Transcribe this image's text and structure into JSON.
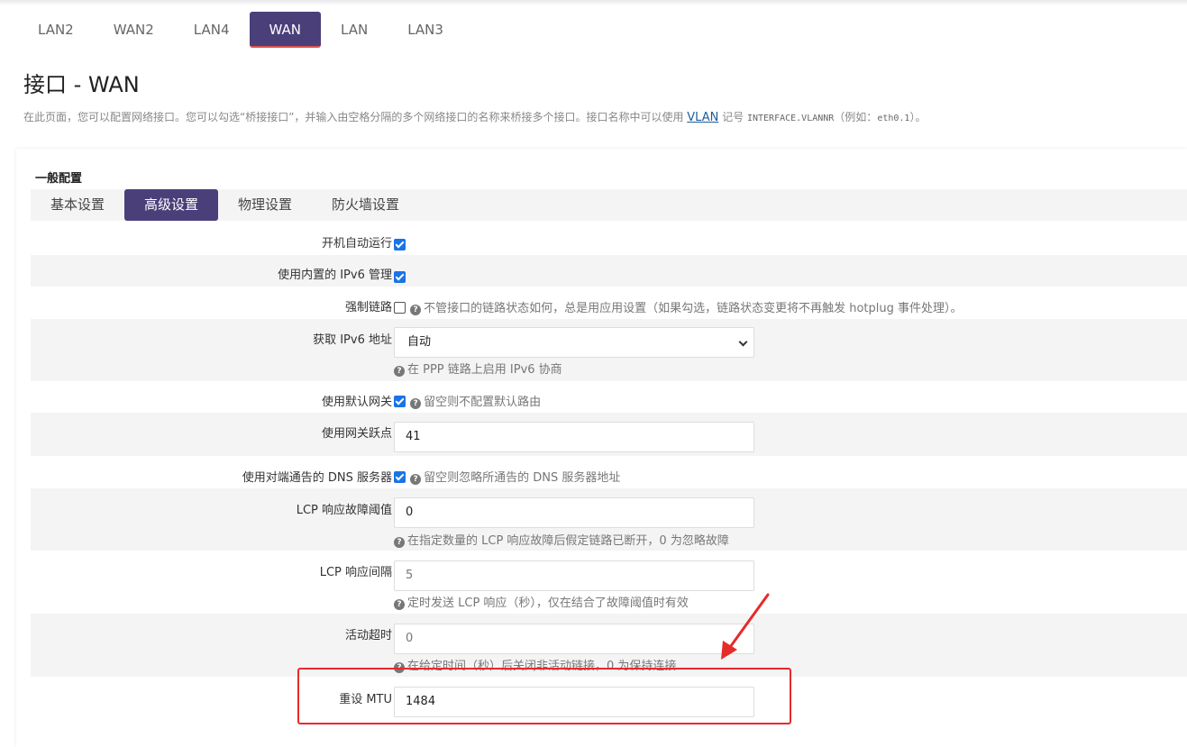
{
  "interface_tabs": [
    {
      "label": "LAN2",
      "active": false
    },
    {
      "label": "WAN2",
      "active": false
    },
    {
      "label": "LAN4",
      "active": false
    },
    {
      "label": "WAN",
      "active": true
    },
    {
      "label": "LAN",
      "active": false
    },
    {
      "label": "LAN3",
      "active": false
    }
  ],
  "page": {
    "title": "接口 - WAN",
    "desc_before": "在此页面，您可以配置网络接口。您可以勾选“桥接接口”，并输入由空格分隔的多个网络接口的名称来桥接多个接口。接口名称中可以使用 ",
    "desc_link": "VLAN",
    "desc_mid": " 记号 ",
    "desc_code": "INTERFACE.VLANNR",
    "desc_after": "（例如：",
    "desc_code2": "eth0.1",
    "desc_end": "）。"
  },
  "section": {
    "title": "一般配置",
    "tabs": [
      {
        "label": "基本设置",
        "active": false
      },
      {
        "label": "高级设置",
        "active": true
      },
      {
        "label": "物理设置",
        "active": false
      },
      {
        "label": "防火墙设置",
        "active": false
      }
    ]
  },
  "fields": {
    "auto_start": {
      "label": "开机自动运行",
      "checked": true
    },
    "builtin_ipv6": {
      "label": "使用内置的 IPv6 管理",
      "checked": true
    },
    "force_link": {
      "label": "强制链路",
      "checked": false,
      "help": "不管接口的链路状态如何，总是用应用设置（如果勾选，链路状态变更将不再触发 hotplug 事件处理）。"
    },
    "ipv6_addr": {
      "label": "获取 IPv6 地址",
      "value": "自动",
      "help": "在 PPP 链路上启用 IPv6 协商"
    },
    "default_gw": {
      "label": "使用默认网关",
      "checked": true,
      "help": "留空则不配置默认路由"
    },
    "gw_metric": {
      "label": "使用网关跃点",
      "value": "41"
    },
    "peer_dns": {
      "label": "使用对端通告的 DNS 服务器",
      "checked": true,
      "help": "留空则忽略所通告的 DNS 服务器地址"
    },
    "lcp_failure": {
      "label": "LCP 响应故障阈值",
      "value": "0",
      "help": "在指定数量的 LCP 响应故障后假定链路已断开，0 为忽略故障"
    },
    "lcp_interval": {
      "label": "LCP 响应间隔",
      "placeholder": "5",
      "help": "定时发送 LCP 响应（秒），仅在结合了故障阈值时有效"
    },
    "idle_timeout": {
      "label": "活动超时",
      "placeholder": "0",
      "help": "在给定时间（秒）后关闭非活动链接，0 为保持连接"
    },
    "mtu": {
      "label": "重设 MTU",
      "value": "1484"
    }
  },
  "colors": {
    "accent": "#4b3f7a",
    "checkbox": "#1a73e8",
    "highlight": "#e62b2b"
  }
}
